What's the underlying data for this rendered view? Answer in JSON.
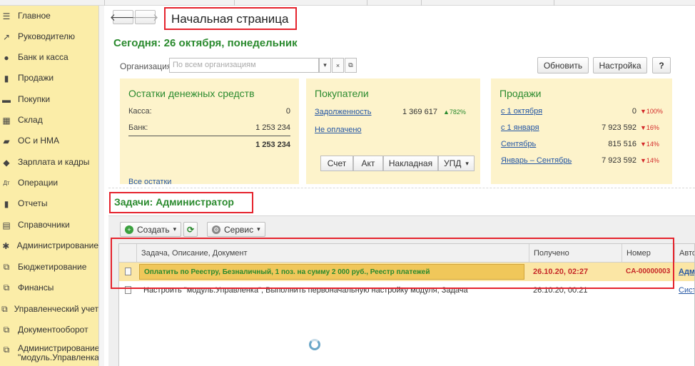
{
  "sidebar": {
    "items": [
      {
        "label": "Главное",
        "icon": "menu-icon",
        "glyph": "☰"
      },
      {
        "label": "Руководителю",
        "icon": "trend-icon",
        "glyph": "↗"
      },
      {
        "label": "Банк и касса",
        "icon": "coin-icon",
        "glyph": "●"
      },
      {
        "label": "Продажи",
        "icon": "bag-icon",
        "glyph": "▮"
      },
      {
        "label": "Покупки",
        "icon": "cart-icon",
        "glyph": "▬"
      },
      {
        "label": "Склад",
        "icon": "box-icon",
        "glyph": "▦"
      },
      {
        "label": "ОС и НМА",
        "icon": "truck-icon",
        "glyph": "▰"
      },
      {
        "label": "Зарплата и кадры",
        "icon": "people-icon",
        "glyph": "◆"
      },
      {
        "label": "Операции",
        "icon": "dt-kt-icon",
        "glyph": "Дт"
      },
      {
        "label": "Отчеты",
        "icon": "bar-chart-icon",
        "glyph": "▮"
      },
      {
        "label": "Справочники",
        "icon": "book-icon",
        "glyph": "▤"
      },
      {
        "label": "Администрирование",
        "icon": "gear-icon",
        "glyph": "✱"
      },
      {
        "label": "Бюджетирование",
        "icon": "subsystem-icon",
        "glyph": "⧉"
      },
      {
        "label": "Финансы",
        "icon": "subsystem-icon",
        "glyph": "⧉"
      },
      {
        "label": "Управленческий учет",
        "icon": "subsystem-icon",
        "glyph": "⧉"
      },
      {
        "label": "Документооборот",
        "icon": "subsystem-icon",
        "glyph": "⧉"
      },
      {
        "label": "Администрирование \"модуль.Управленка\"",
        "icon": "subsystem-icon",
        "glyph": "⧉"
      }
    ]
  },
  "header": {
    "back_glyph": "🡐",
    "forward_glyph": "🡒",
    "title": "Начальная страница"
  },
  "today": "Сегодня: 26 октября, понедельник",
  "org": {
    "label": "Организация:",
    "placeholder": "По всем организациям",
    "dropdown_glyph": "▾",
    "clear_glyph": "×",
    "open_glyph": "⧉"
  },
  "toolbar": {
    "refresh_label": "Обновить",
    "settings_label": "Настройка",
    "help_label": "?"
  },
  "cash": {
    "title": "Остатки денежных средств",
    "rows": [
      {
        "label": "Касса:",
        "value": "0"
      },
      {
        "label": "Банк:",
        "value": "1 253 234"
      }
    ],
    "total": "1 253 234",
    "all_link": "Все остатки"
  },
  "buyers": {
    "title": "Покупатели",
    "debt_link": "Задолженность",
    "debt_value": "1 369 617",
    "debt_delta": "▲782%",
    "unpaid_link": "Не оплачено",
    "buttons": [
      "Счет",
      "Акт",
      "Накладная",
      "УПД"
    ],
    "more_glyph": "▾"
  },
  "sales": {
    "title": "Продажи",
    "rows": [
      {
        "label": "с 1 октября",
        "value": "0",
        "delta": "▼100%",
        "link": true
      },
      {
        "label": "с 1 января",
        "value": "7 923 592",
        "delta": "▼16%",
        "link": true
      },
      {
        "label": "Сентябрь",
        "value": "815 516",
        "delta": "▼14%",
        "link": true
      },
      {
        "label": "Январь – Сентябрь",
        "value": "7 923 592",
        "delta": "▼14%",
        "link": true
      }
    ]
  },
  "tasks": {
    "title": "Задачи: Администратор",
    "create_label": "Создать",
    "service_label": "Сервис",
    "columns": [
      "Задача, Описание, Документ",
      "Получено",
      "Номер",
      "Авто"
    ],
    "rows": [
      {
        "task": "Оплатить по Реестру, Безналичный, 1 поз. на сумму 2 000 руб., Реестр платежей",
        "received": "26.10.20, 02:27",
        "number": "CA-00000003",
        "author": "Адм"
      },
      {
        "task": "Настроить \"модуль.Управленка\", Выполнить первоначальную настройку модуля, Задача",
        "received": "26.10.20, 00:21",
        "number": "",
        "author": "Сист"
      }
    ]
  },
  "colors": {
    "accent_green": "#2a8a2e",
    "sidebar_bg": "#fbeda8",
    "card_bg": "#fdf3cb",
    "highlight_red": "#e5232d",
    "link_blue": "#2456a4"
  }
}
